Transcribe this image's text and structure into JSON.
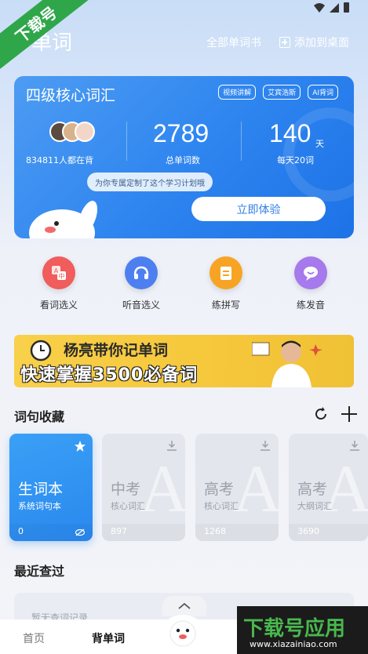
{
  "header": {
    "title": "单词",
    "all_wordbooks": "全部单词书",
    "add_desktop": "添加到桌面"
  },
  "watermark": {
    "corner": "下载号",
    "bottom_title": "下载号应用",
    "bottom_url": "www.xiazainiao.com"
  },
  "hero": {
    "title": "四级核心词汇",
    "tags": [
      "视频讲解",
      "艾宾浩斯",
      "AI背词"
    ],
    "learners": "834811人都在背",
    "total_words": "2789",
    "total_words_label": "总单词数",
    "days": "140",
    "days_unit": "天",
    "days_label": "每天20词",
    "bubble": "为你专属定制了这个学习计划哦",
    "cta": "立即体验"
  },
  "features": [
    {
      "label": "看词选义",
      "color": "#f15c5c"
    },
    {
      "label": "听音选义",
      "color": "#4d7ff0"
    },
    {
      "label": "练拼写",
      "color": "#f7a425"
    },
    {
      "label": "练发音",
      "color": "#a679ec"
    }
  ],
  "banner": {
    "line1": "杨亮带你记单词",
    "line2": "快速掌握3500必备词"
  },
  "collection": {
    "title": "词句收藏",
    "cards": [
      {
        "name": "生词本",
        "sub": "系统词句本",
        "count": "0",
        "active": true
      },
      {
        "name": "中考",
        "sub": "核心词汇",
        "count": "897",
        "active": false
      },
      {
        "name": "高考",
        "sub": "核心词汇",
        "count": "1268",
        "active": false
      },
      {
        "name": "高考",
        "sub": "大纲词汇",
        "count": "3690",
        "active": false
      }
    ]
  },
  "recent": {
    "title": "最近查过",
    "item": "暂无查词记录"
  },
  "tabs": {
    "home": "首页",
    "words": "背单词"
  }
}
